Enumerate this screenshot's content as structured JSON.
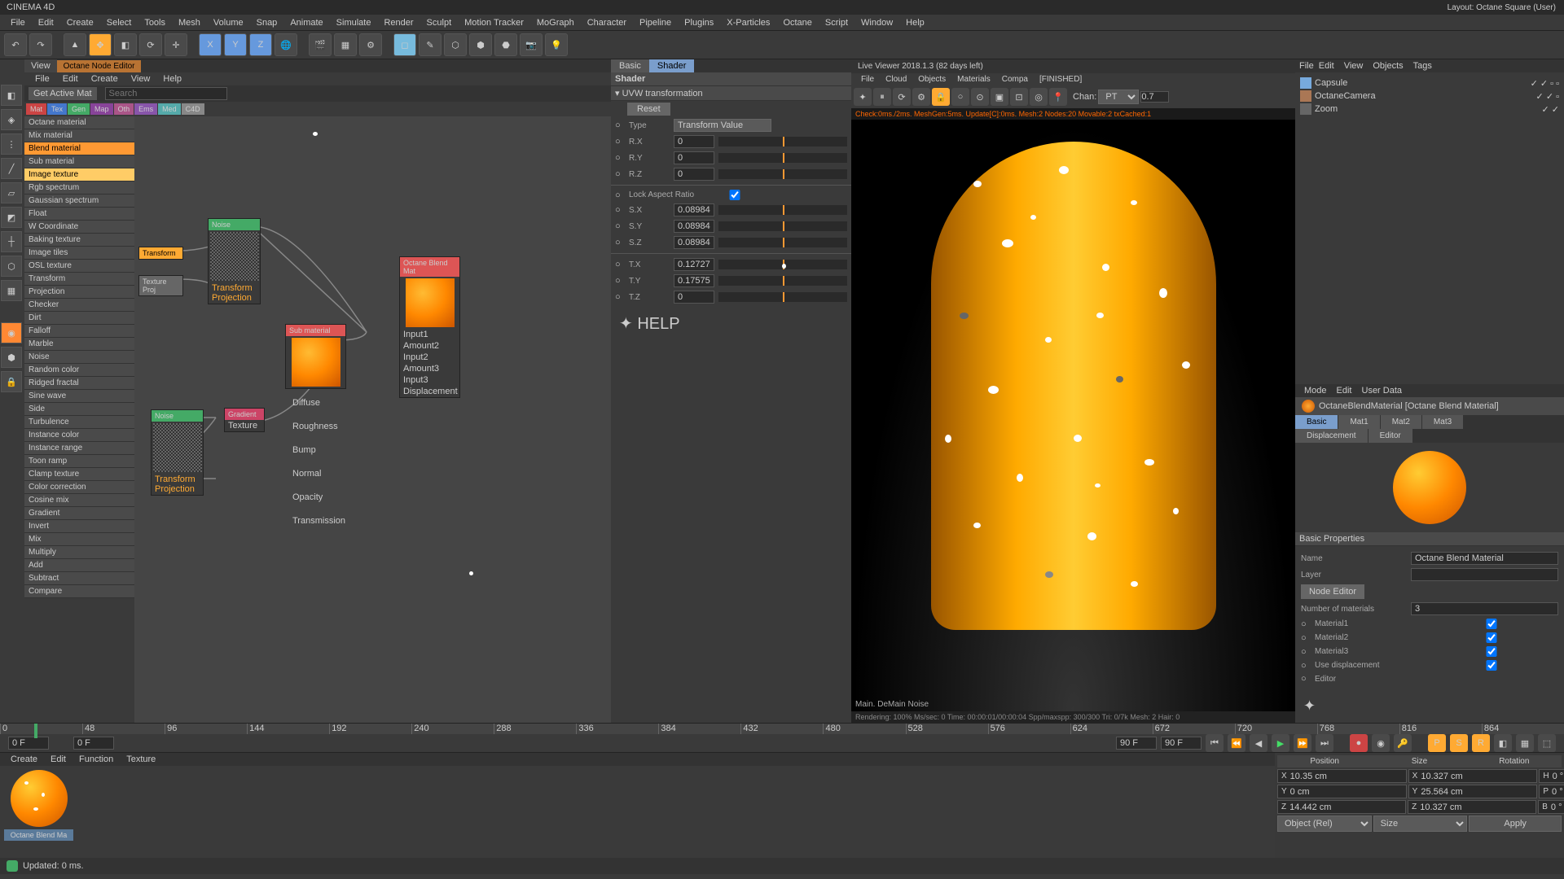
{
  "app_title": "CINEMA 4D",
  "layout_text": "Layout:  Octane Square (User)",
  "main_menu": [
    "File",
    "Edit",
    "Create",
    "Select",
    "Tools",
    "Mesh",
    "Volume",
    "Snap",
    "Animate",
    "Simulate",
    "Render",
    "Sculpt",
    "Motion Tracker",
    "MoGraph",
    "Character",
    "Pipeline",
    "Plugins",
    "X-Particles",
    "Octane",
    "Script",
    "Window",
    "Help"
  ],
  "node_editor": {
    "tab_view": "View",
    "tab_name": "Octane Node Editor",
    "menu": [
      "File",
      "Edit",
      "Create",
      "View",
      "Help"
    ],
    "get_active": "Get Active Mat",
    "search_placeholder": "Search",
    "categories": [
      "Mat",
      "Tex",
      "Gen",
      "Map",
      "Oth",
      "Ems",
      "Med",
      "C4D"
    ],
    "list": [
      "Octane material",
      "Mix material",
      "Blend material",
      "Sub material",
      "Image texture",
      "Rgb spectrum",
      "Gaussian spectrum",
      "Float",
      "W Coordinate",
      "Baking texture",
      "Image tiles",
      "OSL texture",
      "Transform",
      "Projection",
      "Checker",
      "Dirt",
      "Falloff",
      "Marble",
      "Noise",
      "Random color",
      "Ridged fractal",
      "Sine wave",
      "Side",
      "Turbulence",
      "Instance color",
      "Instance range",
      "Toon ramp",
      "Clamp texture",
      "Color correction",
      "Cosine mix",
      "Gradient",
      "Invert",
      "Mix",
      "Multiply",
      "Add",
      "Subtract",
      "Compare"
    ],
    "highlighted": [
      "Blend material",
      "Image texture"
    ],
    "nodes": {
      "transform": "Transform",
      "texture_proj": "Texture Proj",
      "noise1": "Noise",
      "noise2": "Noise",
      "gradient": "Gradient",
      "texture": "Texture",
      "transform_projection": "Transform Projection",
      "sub_material": "Sub material",
      "blend_mat": "Octane Blend Mat",
      "diffuse": "Diffuse",
      "roughness": "Roughness",
      "bump": "Bump",
      "normal": "Normal",
      "opacity": "Opacity",
      "transmission": "Transmission",
      "inputs": [
        "Input1",
        "Amount2",
        "Input2",
        "Amount3",
        "Input3",
        "Displacement"
      ]
    }
  },
  "shader_panel": {
    "tab_basic": "Basic",
    "tab_shader": "Shader",
    "title": "Shader",
    "section": "UVW transformation",
    "reset": "Reset",
    "type_label": "Type",
    "type_value": "Transform Value",
    "rows": [
      {
        "label": "R.X",
        "value": "0"
      },
      {
        "label": "R.Y",
        "value": "0"
      },
      {
        "label": "R.Z",
        "value": "0"
      }
    ],
    "lock_aspect": "Lock Aspect Ratio",
    "scale_rows": [
      {
        "label": "S.X",
        "value": "0.089844"
      },
      {
        "label": "S.Y",
        "value": "0.089844"
      },
      {
        "label": "S.Z",
        "value": "0.089844"
      }
    ],
    "trans_rows": [
      {
        "label": "T.X",
        "value": "0.127273"
      },
      {
        "label": "T.Y",
        "value": "0.175758"
      },
      {
        "label": "T.Z",
        "value": "0"
      }
    ]
  },
  "viewer": {
    "title": "Live Viewer 2018.1.3 (82 days left)",
    "menu": [
      "File",
      "Cloud",
      "Objects",
      "Materials",
      "Compa",
      "[FINISHED]"
    ],
    "chan": "Chan:",
    "pt": "PT",
    "pt_val": "0.7",
    "status": "Check:0ms./2ms. MeshGen:5ms. Update[C]:0ms. Mesh:2 Nodes:20 Movable:2 txCached:1",
    "footer_main": "Main. DeMain Noise",
    "footer_render": "Rendering: 100%  Ms/sec: 0  Time: 00:00:01/00:00:04  Spp/maxspp: 300/300  Tri: 0/7k  Mesh: 2  Hair: 0"
  },
  "scene_tree": {
    "menu": [
      "File",
      "Edit",
      "View",
      "Objects",
      "Tags"
    ],
    "items": [
      "Capsule",
      "OctaneCamera",
      "Zoom"
    ]
  },
  "attr": {
    "menu": [
      "Mode",
      "Edit",
      "User Data"
    ],
    "title": "OctaneBlendMaterial [Octane Blend Material]",
    "tabs": [
      "Basic",
      "Mat1",
      "Mat2",
      "Mat3"
    ],
    "tabs2": [
      "Displacement",
      "Editor"
    ],
    "section": "Basic Properties",
    "props": {
      "name_label": "Name",
      "name_value": "Octane Blend Material",
      "layer_label": "Layer",
      "node_editor": "Node Editor",
      "num_mat_label": "Number of materials",
      "num_mat_value": "3",
      "mat1": "Material1",
      "mat2": "Material2",
      "mat3": "Material3",
      "use_disp": "Use displacement",
      "editor": "Editor"
    }
  },
  "timeline": {
    "frames": [
      "0",
      "48",
      "96",
      "144",
      "192",
      "240",
      "288",
      "336",
      "384",
      "432",
      "480",
      "528",
      "576",
      "624",
      "672",
      "720",
      "768",
      "816",
      "864"
    ],
    "start": "0 F",
    "end": "90 F",
    "current": "0 F",
    "end2": "90 F"
  },
  "materials": {
    "menu": [
      "Create",
      "Edit",
      "Function",
      "Texture"
    ],
    "item_name": "Octane Blend Ma"
  },
  "coords": {
    "headers": [
      "Position",
      "Size",
      "Rotation"
    ],
    "rows": [
      {
        "axis": "X",
        "pos": "10.35 cm",
        "size": "10.327 cm",
        "rot_label": "H",
        "rot": "0 °"
      },
      {
        "axis": "Y",
        "pos": "0 cm",
        "size": "25.564 cm",
        "rot_label": "P",
        "rot": "0 °"
      },
      {
        "axis": "Z",
        "pos": "14.442 cm",
        "size": "10.327 cm",
        "rot_label": "B",
        "rot": "0 °"
      }
    ],
    "obj_rel": "Object (Rel)",
    "size_mode": "Size",
    "apply": "Apply"
  },
  "status": "Updated: 0 ms."
}
